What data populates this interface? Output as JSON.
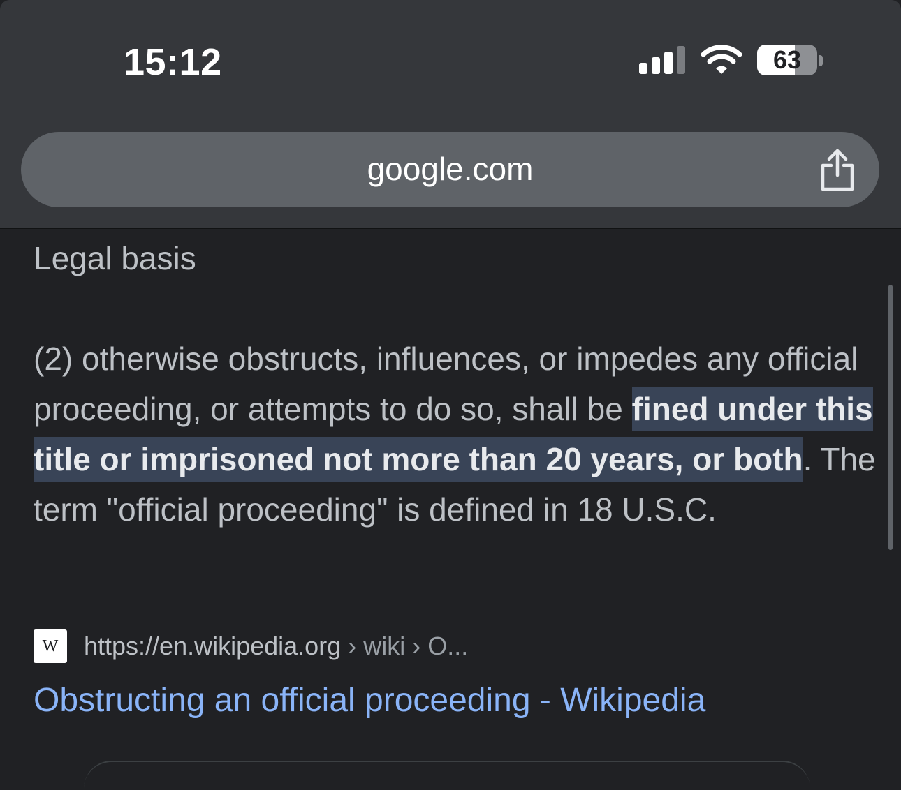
{
  "status_bar": {
    "time": "15:12",
    "battery_level": "63",
    "battery_fraction": 0.63,
    "signal_bars": 3,
    "signal_bars_total": 4,
    "icons": [
      "signal-icon",
      "wifi-icon",
      "battery-icon"
    ]
  },
  "browser": {
    "url": "google.com",
    "share_icon": "share-icon"
  },
  "content": {
    "section_heading": "Legal basis",
    "snippet": {
      "before": "(2) otherwise obstructs, influences, or impedes any official proceeding, or attempts to do so, shall be ",
      "highlight": "fined under this title or imprisoned not more than 20 years, or both",
      "after": ". The term \"official proceeding\" is defined in 18 U.S.C."
    },
    "source": {
      "favicon_letter": "W",
      "url": "https://en.wikipedia.org",
      "crumbs": " › wiki › O..."
    },
    "result_title": "Obstructing an official proceeding - Wikipedia"
  },
  "colors": {
    "background": "#202124",
    "topbar": "#35373b",
    "urlbar": "#5f6368",
    "link": "#8ab4f8",
    "highlight_bg": "#394457"
  }
}
